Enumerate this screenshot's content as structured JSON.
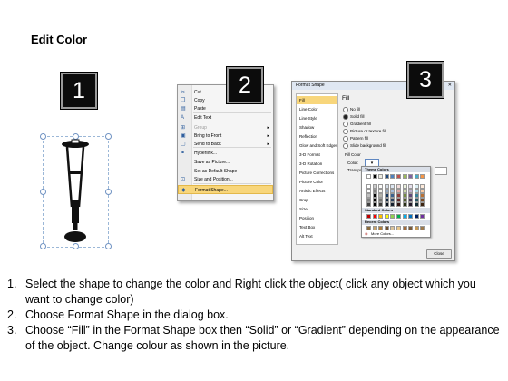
{
  "title": "Edit Color",
  "badges": [
    "1",
    "2",
    "3"
  ],
  "context_menu": {
    "items": [
      {
        "label": "Cut",
        "icon": "cut-icon",
        "glyph": "✂"
      },
      {
        "label": "Copy",
        "icon": "copy-icon",
        "glyph": "❐"
      },
      {
        "label": "Paste",
        "icon": "paste-icon",
        "glyph": "▤"
      },
      {
        "label": "Edit Text",
        "icon": "edit-text-icon",
        "glyph": "A"
      },
      {
        "label": "Group",
        "icon": "group-icon",
        "glyph": "⊞",
        "disabled": true,
        "submenu": true
      },
      {
        "label": "Bring to Front",
        "icon": "bring-front-icon",
        "glyph": "▣",
        "submenu": true
      },
      {
        "label": "Send to Back",
        "icon": "send-back-icon",
        "glyph": "▢",
        "submenu": true
      },
      {
        "label": "Hyperlink...",
        "icon": "hyperlink-icon",
        "glyph": "⚭"
      },
      {
        "label": "Save as Picture...",
        "icon": "",
        "glyph": ""
      },
      {
        "label": "Set as Default Shape",
        "icon": "",
        "glyph": ""
      },
      {
        "label": "Size and Position...",
        "icon": "size-position-icon",
        "glyph": "⊡"
      },
      {
        "label": "Format Shape...",
        "icon": "format-shape-icon",
        "glyph": "◆",
        "highlighted": true
      }
    ]
  },
  "dialog": {
    "title": "Format Shape",
    "nav": [
      "Fill",
      "Line Color",
      "Line Style",
      "Shadow",
      "Reflection",
      "Glow and Soft Edges",
      "3-D Format",
      "3-D Rotation",
      "Picture Corrections",
      "Picture Color",
      "Artistic Effects",
      "Crop",
      "Size",
      "Position",
      "Text Box",
      "Alt Text"
    ],
    "section_title": "Fill",
    "options": [
      "No fill",
      "Solid fill",
      "Gradient fill",
      "Picture or texture fill",
      "Pattern fill",
      "Slide background fill"
    ],
    "selected_option": 1,
    "fill_color_label": "Fill Color",
    "color_label": "Color:",
    "transparency_label": "Transpa",
    "palette": {
      "theme_label": "Theme Colors",
      "standard_label": "Standard Colors",
      "recent_label": "Recent Colors",
      "more_label": "More Colors...",
      "theme_top": [
        "#ffffff",
        "#000000",
        "#eeece1",
        "#1f497d",
        "#4f81bd",
        "#c0504d",
        "#9bbb59",
        "#8064a2",
        "#4bacc6",
        "#f79646"
      ],
      "standard": [
        "#c00000",
        "#ff0000",
        "#ffc000",
        "#ffff00",
        "#92d050",
        "#00b050",
        "#00b0f0",
        "#0070c0",
        "#002060",
        "#7030a0"
      ],
      "recent": [
        "#8b6b3d",
        "#c8a26b",
        "#b07f3f",
        "#6f4f2f",
        "#d9c29a",
        "#e6c58a",
        "#a36b3a",
        "#7a5a38",
        "#c79a56",
        "#9d7a4e"
      ]
    },
    "close_label": "Close"
  },
  "steps": [
    {
      "num": "1.",
      "text": "Select the shape to change the color and Right click the object( click any object which you want to change color)"
    },
    {
      "num": "2.",
      "text": "Choose Format Shape in the dialog box."
    },
    {
      "num": "3.",
      "text": "Choose “Fill” in the Format Shape box then “Solid” or “Gradient” depending on the appearance of the object. Change colour as shown in the picture."
    }
  ]
}
